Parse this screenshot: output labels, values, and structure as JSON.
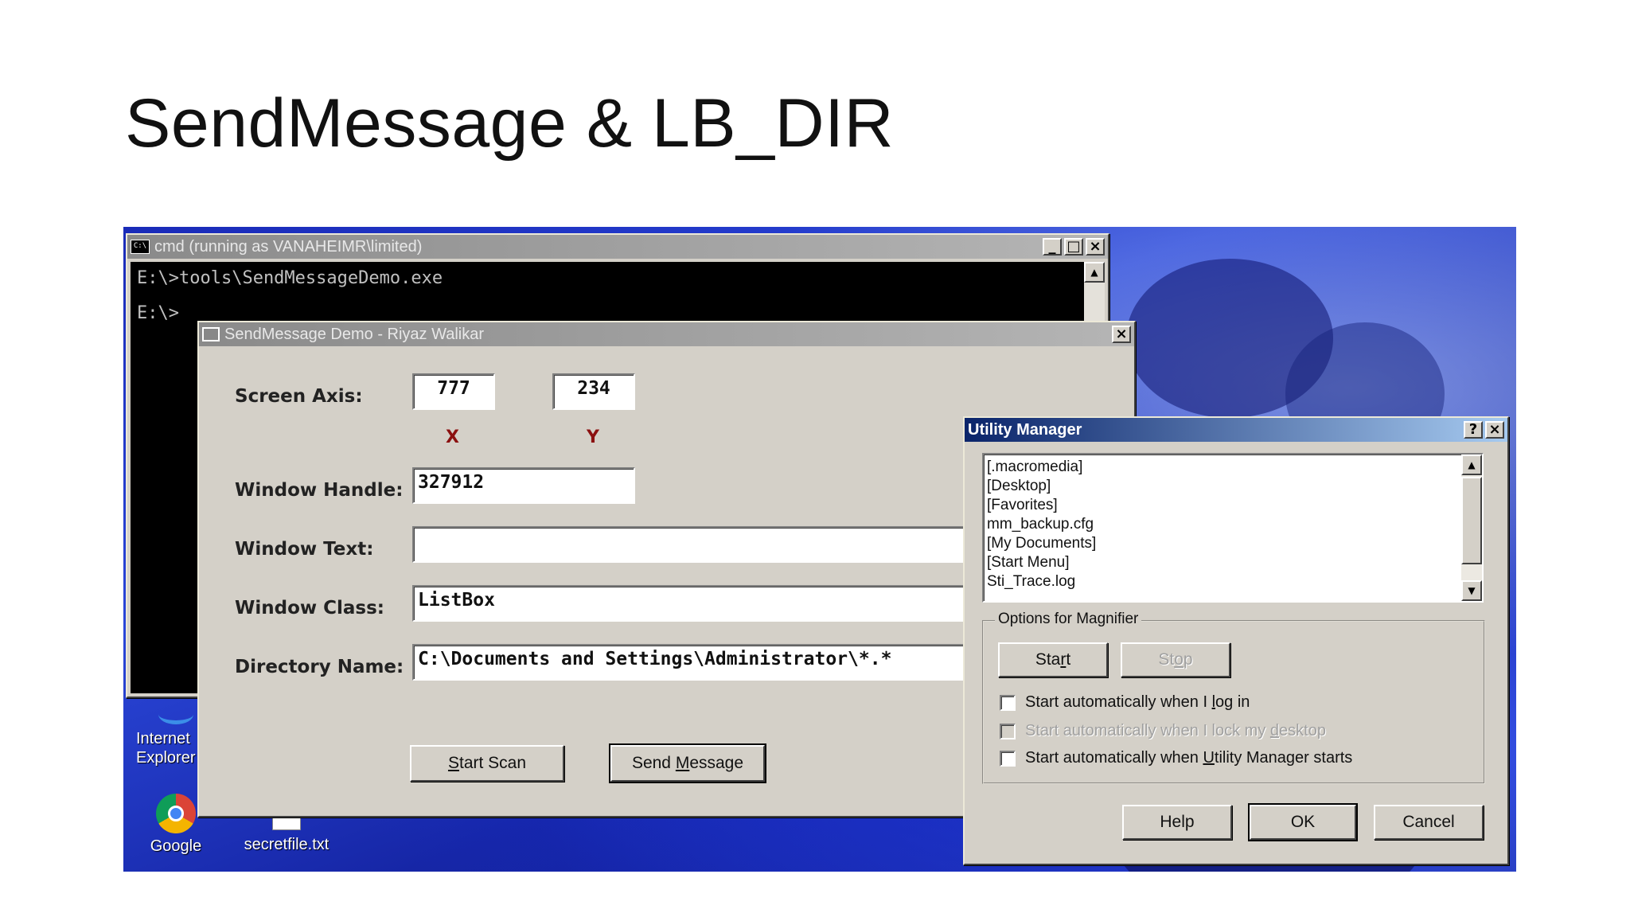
{
  "slide": {
    "title": "SendMessage & LB_DIR"
  },
  "cmd_window": {
    "title": "cmd (running as VANAHEIMR\\limited)",
    "lines": [
      "E:\\>tools\\SendMessageDemo.exe",
      "E:\\>"
    ]
  },
  "desktop_icons": {
    "ie": "Internet Explorer",
    "google": "Google",
    "secretfile": "secretfile.txt"
  },
  "sendmessage_demo": {
    "title": "SendMessage Demo - Riyaz Walikar",
    "screen_axis_label": "Screen Axis:",
    "x_value": "777",
    "y_value": "234",
    "x_label": "X",
    "y_label": "Y",
    "window_handle_label": "Window Handle:",
    "window_handle_value": "327912",
    "window_text_label": "Window Text:",
    "window_text_value": "",
    "window_class_label": "Window Class:",
    "window_class_value": "ListBox",
    "directory_name_label": "Directory Name:",
    "directory_name_value": "C:\\Documents and Settings\\Administrator\\*.*",
    "start_scan_button": {
      "mnemonic": "S",
      "rest": "tart Scan"
    },
    "send_message_button": {
      "before": "Send ",
      "mnemonic": "M",
      "after": "essage"
    }
  },
  "utility_manager": {
    "title": "Utility Manager",
    "list_items": [
      "[.macromedia]",
      "[Desktop]",
      "[Favorites]",
      "mm_backup.cfg",
      "[My Documents]",
      "[Start Menu]",
      "Sti_Trace.log"
    ],
    "group_label": "Options for Magnifier",
    "start_button": {
      "before": "Sta",
      "mnemonic": "r",
      "after": "t"
    },
    "stop_button": {
      "before": "St",
      "mnemonic": "o",
      "after": "p"
    },
    "checkbox_1": {
      "before": "Start automatically when I ",
      "mnemonic": "l",
      "after": "og in",
      "checked": false
    },
    "checkbox_2": {
      "before": "Start automatically when I lock my ",
      "mnemonic": "d",
      "after": "esktop",
      "checked": false,
      "disabled": true
    },
    "checkbox_3": {
      "before": "Start automatically when ",
      "mnemonic": "U",
      "after": "tility Manager starts",
      "checked": false
    },
    "help_button": "Help",
    "ok_button": "OK",
    "cancel_button": "Cancel"
  }
}
